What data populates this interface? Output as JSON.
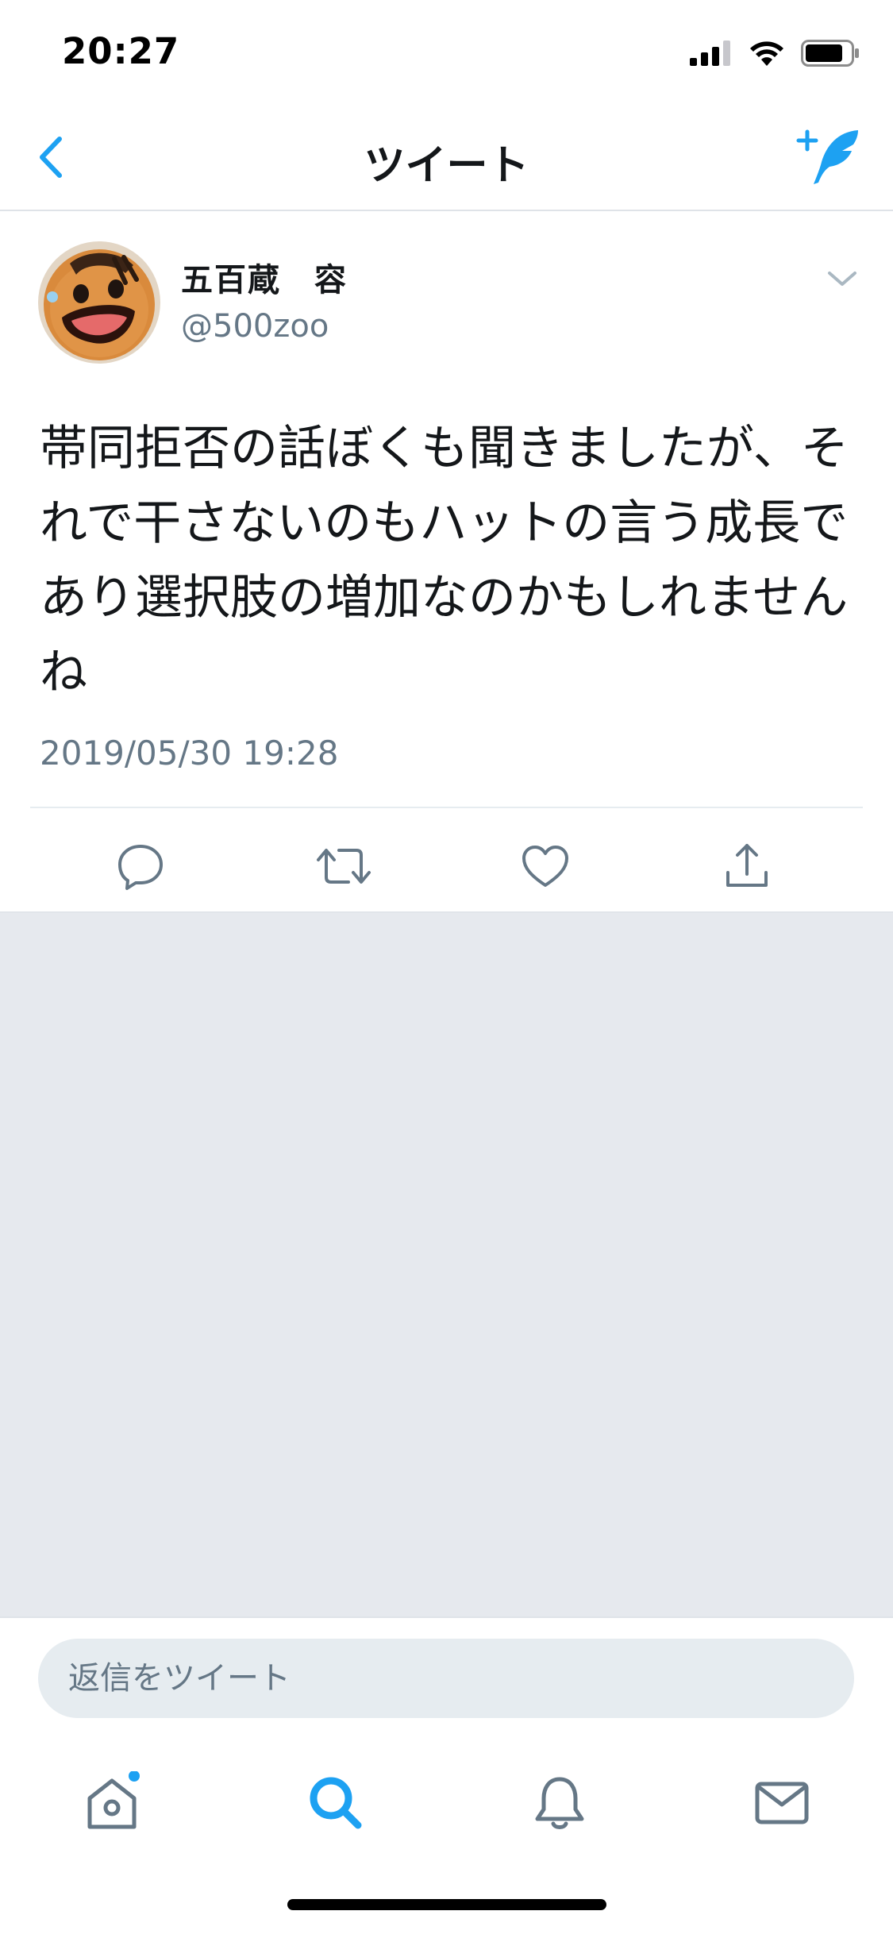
{
  "status_bar": {
    "time": "20:27"
  },
  "nav": {
    "title": "ツイート",
    "back_icon": "chevron-left-icon",
    "compose_icon": "compose-tweet-icon"
  },
  "tweet": {
    "author_name": "五百蔵　容",
    "author_handle": "@500zoo",
    "text": "帯同拒否の話ぼくも聞きましたが、それで干さないのもハットの言う成長であり選択肢の増加なのかもしれませんね",
    "timestamp": "2019/05/30 19:28"
  },
  "actions": [
    "reply-icon",
    "retweet-icon",
    "like-icon",
    "share-icon"
  ],
  "reply": {
    "placeholder": "返信をツイート"
  },
  "tabs": [
    "home-icon",
    "search-icon",
    "notifications-icon",
    "messages-icon"
  ],
  "colors": {
    "accent": "#1da1f2",
    "text": "#14171a",
    "secondary": "#657786",
    "background_gray": "#e6e9ee"
  }
}
